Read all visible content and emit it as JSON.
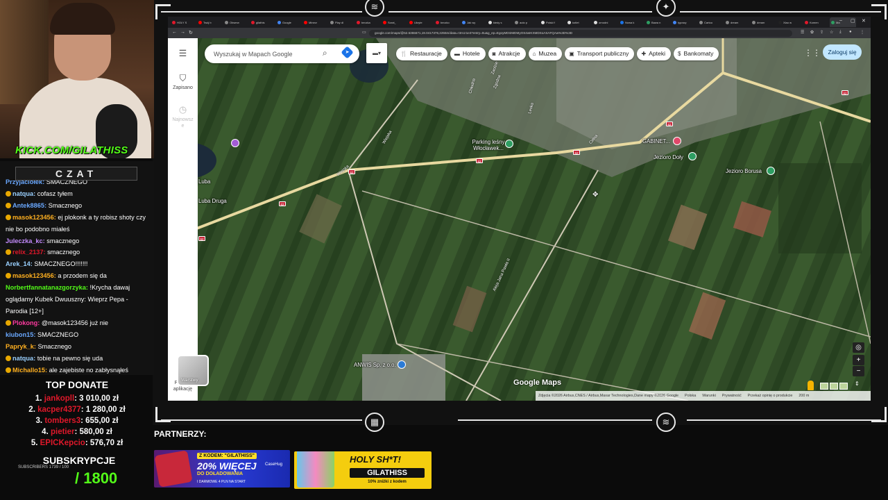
{
  "stream": {
    "kick_handle": "KICK.COM/GILATHISS",
    "chat_title": "CZAT",
    "chat_messages": [
      {
        "user": "Przyjaciołek:",
        "text": "SMACZNEGO",
        "color": "#6aa8ff",
        "badge": false
      },
      {
        "user": "natqua:",
        "text": "cofasz tyłem",
        "color": "#9ad0ff",
        "badge": true
      },
      {
        "user": "Antek8865:",
        "text": "Smacznego",
        "color": "#6aa8ff",
        "badge": true
      },
      {
        "user": "masok123456:",
        "text": "ej plokonk a ty robisz shoty czy nie bo podobno miałeś",
        "color": "#ffb020",
        "badge": true
      },
      {
        "user": "Juleczka_kc:",
        "text": "smacznego",
        "color": "#c48cff",
        "badge": false
      },
      {
        "user": "relix_2137:",
        "text": "smacznego",
        "color": "#e0182a",
        "badge": true
      },
      {
        "user": "Arek_14:",
        "text": "SMACZNEGO!!!!!!!",
        "color": "#9ad0ff",
        "badge": false
      },
      {
        "user": "masok123456:",
        "text": "a przodem się da",
        "color": "#ffb020",
        "badge": true
      },
      {
        "user": "Norbertfannatanazgorzyka:",
        "text": "!Krycha dawaj oglądamy Kubek Dwuuszny: Wieprz Pepa - Parodia [12+]",
        "color": "#53fc18",
        "badge": false
      },
      {
        "user": "Plokong:",
        "text": "@masok123456 już nie",
        "color": "#ff3aa0",
        "badge": true
      },
      {
        "user": "kiubon15:",
        "text": "SMACZNEGO",
        "color": "#6aa8ff",
        "badge": false
      },
      {
        "user": "Papryk_k:",
        "text": "Smacznego",
        "color": "#ffb020",
        "badge": false
      },
      {
        "user": "natqua:",
        "text": "tobie na pewno się uda",
        "color": "#9ad0ff",
        "badge": true
      },
      {
        "user": "Michallo15:",
        "text": "ale zajebiste no zabłysnąłeś",
        "color": "#ffb020",
        "badge": true
      }
    ],
    "donate_title": "TOP DONATE",
    "donates": [
      {
        "rank": "1.",
        "name": "jankopll",
        "amount": ": 3 010,00 zł"
      },
      {
        "rank": "2.",
        "name": "kacper4377",
        "amount": ": 1 280,00 zł"
      },
      {
        "rank": "3.",
        "name": "tombers3",
        "amount": ": 655,00 zł"
      },
      {
        "rank": "4.",
        "name": "pietier",
        "amount": ": 580,00 zł"
      },
      {
        "rank": "5.",
        "name": "EPICKepcio",
        "amount": ": 576,70 zł"
      }
    ],
    "subs_title": "SUBSKRYPCJE",
    "subs_small": "SUBSCRIBERS 1739 / 100",
    "subs_goal": "/ 1800",
    "partners_label": "PARTNERZY:",
    "banner1": {
      "code": "Z KODEM: \"GILATHISS\"",
      "big": "20% WIĘCEJ",
      "sub": "DO DOŁADOWANIA",
      "small": "I DARMOWE 4 PLN NA START",
      "brand": "CaseHug"
    },
    "banner2": {
      "t1": "HOLY SH*T!",
      "t2": "GILATHISS",
      "t3": "10% zniżki z kodem"
    }
  },
  "browser": {
    "tabs": [
      "HOLY S",
      "Twój b",
      "Obserw",
      "gilathis",
      "Google",
      "Minecr",
      "Play dl",
      "beczka",
      "Sorat_",
      "Ukryte",
      "beczko",
      "Jak wy",
      "kiedy s",
      "auto p",
      "Polski f",
      "kotlet",
      "ornodni",
      "Nowa k",
      "Bawa n",
      "typowy",
      "Cartoo",
      "dream",
      "dream",
      "Xiao w",
      "Komen",
      "Ma"
    ],
    "url": "google.com/maps/@52.6355671,19.0417376,2255m/data=!3m1!1e3?entry=ttu&g_ep=EgoyMDI2MDMyOS4wIKXMDSoASAFQAw%3D%3D"
  },
  "maps": {
    "search_placeholder": "Wyszukaj w Mapach Google",
    "rail": {
      "saved": "Zapisano",
      "recent": "Najnowsz e",
      "get_app": "Pobierz aplikację"
    },
    "chips": [
      {
        "label": "Restauracje",
        "icon": "fork-knife-icon"
      },
      {
        "label": "Hotele",
        "icon": "bed-icon"
      },
      {
        "label": "Atrakcje",
        "icon": "camera-icon"
      },
      {
        "label": "Muzea",
        "icon": "museum-icon"
      },
      {
        "label": "Transport publiczny",
        "icon": "bus-icon"
      },
      {
        "label": "Apteki",
        "icon": "pharmacy-icon"
      },
      {
        "label": "Bankomaty",
        "icon": "atm-icon"
      }
    ],
    "login": "Zaloguj się",
    "layers": "Warstwy",
    "logo": "Google Maps",
    "attribution": [
      "Zdjęcia ©2026 Airbus,CNES / Airbus,Maxar Technologies,Dane mapy ©2026 Google",
      "Polska",
      "Warunki",
      "Prywatność",
      "Przekaż opinię o produkcie",
      "200 m"
    ],
    "places": {
      "parking": "Parking leśny Włocławek...",
      "gabinet": "GABINET...",
      "jezioro_doly": "Jezioro Doły",
      "jezioro_borusa": "Jezioro Borusa",
      "luba": "Luba",
      "luba_druga": "Luba Druga",
      "anwis": "ANWIS Sp. z o.o."
    },
    "roads": {
      "wiejska1": "Wiejska",
      "wiejska2": "Wiejska",
      "aleja": "Aleja Jana Pawła II",
      "zgodna": "Zgodna",
      "celna": "Celna",
      "leska": "Leska",
      "chlodna": "Chłodna",
      "zaolzie": "Zaolzie"
    },
    "route_number": "62"
  }
}
